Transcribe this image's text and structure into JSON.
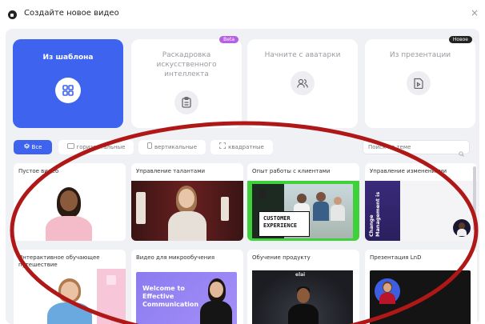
{
  "dialog": {
    "title": "Создайте новое видео",
    "close": "×"
  },
  "options": [
    {
      "label": "Из шаблона",
      "icon": "grid-icon",
      "active": true
    },
    {
      "label": "Раскадровка искусственного интеллекта",
      "icon": "clipboard-icon",
      "badge": "Beta"
    },
    {
      "label": "Начните с аватарки",
      "icon": "users-icon"
    },
    {
      "label": "Из презентации",
      "icon": "presentation-file-icon",
      "badge": "Новое"
    }
  ],
  "filters": {
    "all": "Все",
    "horizontal": "горизонтальные",
    "vertical": "вертикальные",
    "square": "квадратные",
    "search_placeholder": "Поиск по теме"
  },
  "templates": [
    {
      "title": "Пустое видео"
    },
    {
      "title": "Управление талантами"
    },
    {
      "title": "Опыт работы с клиентами",
      "thumb_text": [
        "CUSTOMER",
        "EXPERIENCE"
      ]
    },
    {
      "title": "Управление изменениями",
      "thumb_text": [
        "Change",
        "Management is"
      ]
    },
    {
      "title": "Интерактивное обучающее путешествие"
    },
    {
      "title": "Видео для микрообучения",
      "thumb_text": [
        "Welcome to",
        "Effective",
        "Communication"
      ]
    },
    {
      "title": "Обучение продукту",
      "thumb_text": [
        "elai"
      ]
    },
    {
      "title": "Презентация LnD"
    }
  ],
  "colors": {
    "accent": "#3d63ef",
    "annotation": "#b01818"
  }
}
